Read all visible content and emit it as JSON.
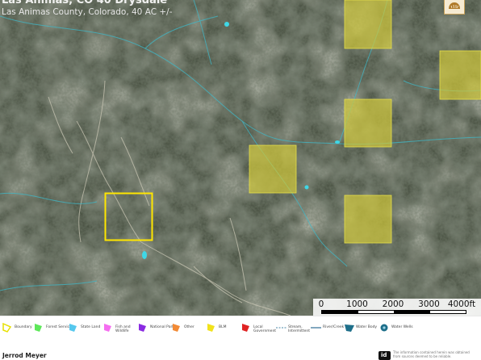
{
  "header": {
    "title": "Las Animas, CO 40 Drysdale",
    "subtitle": "Las Animas County, Colorado, 40 AC +/-"
  },
  "map": {
    "type": "satellite-imagery",
    "terrain_color": "#4c5445",
    "stream_color": "#3fb8c8",
    "boundary_color": "#ffe600",
    "blm_fill": "#d4cc3a"
  },
  "scale": {
    "labels": [
      "0",
      "1000",
      "2000",
      "3000",
      "4000ft"
    ]
  },
  "legend": {
    "items": [
      {
        "label": "Boundary",
        "icon": "boundary-icon",
        "color": "#e7e000"
      },
      {
        "label": "Forest Servic",
        "icon": "forest-service-icon",
        "color": "#5ee85a"
      },
      {
        "label": "State Land",
        "icon": "state-land-icon",
        "color": "#56c8ee"
      },
      {
        "label": "Fish and Wildlife",
        "icon": "fish-wildlife-icon",
        "color": "#f56ef0"
      },
      {
        "label": "National Park",
        "icon": "national-park-icon",
        "color": "#8a2be2"
      },
      {
        "label": "Other",
        "icon": "other-icon",
        "color": "#f28a36"
      },
      {
        "label": "BLM",
        "icon": "blm-icon",
        "color": "#f1e21c"
      },
      {
        "label": "Local Government",
        "icon": "local-government-icon",
        "color": "#e02424"
      },
      {
        "label": "Stream, Intermittent",
        "icon": "stream-intermittent-icon",
        "color": "#4a88a8"
      },
      {
        "label": "River/Creek",
        "icon": "river-creek-icon",
        "color": "#2e6f94"
      },
      {
        "label": "Water Body",
        "icon": "water-body-icon",
        "color": "#1e6f8a"
      },
      {
        "label": "Water Wells",
        "icon": "water-wells-icon",
        "color": "#1e6f8a"
      }
    ]
  },
  "footer": {
    "agent_name": "Jerrod Meyer",
    "disclaimer": "The information contained herein was obtained from sources deemed to be reliable.",
    "logo_text": "id"
  }
}
